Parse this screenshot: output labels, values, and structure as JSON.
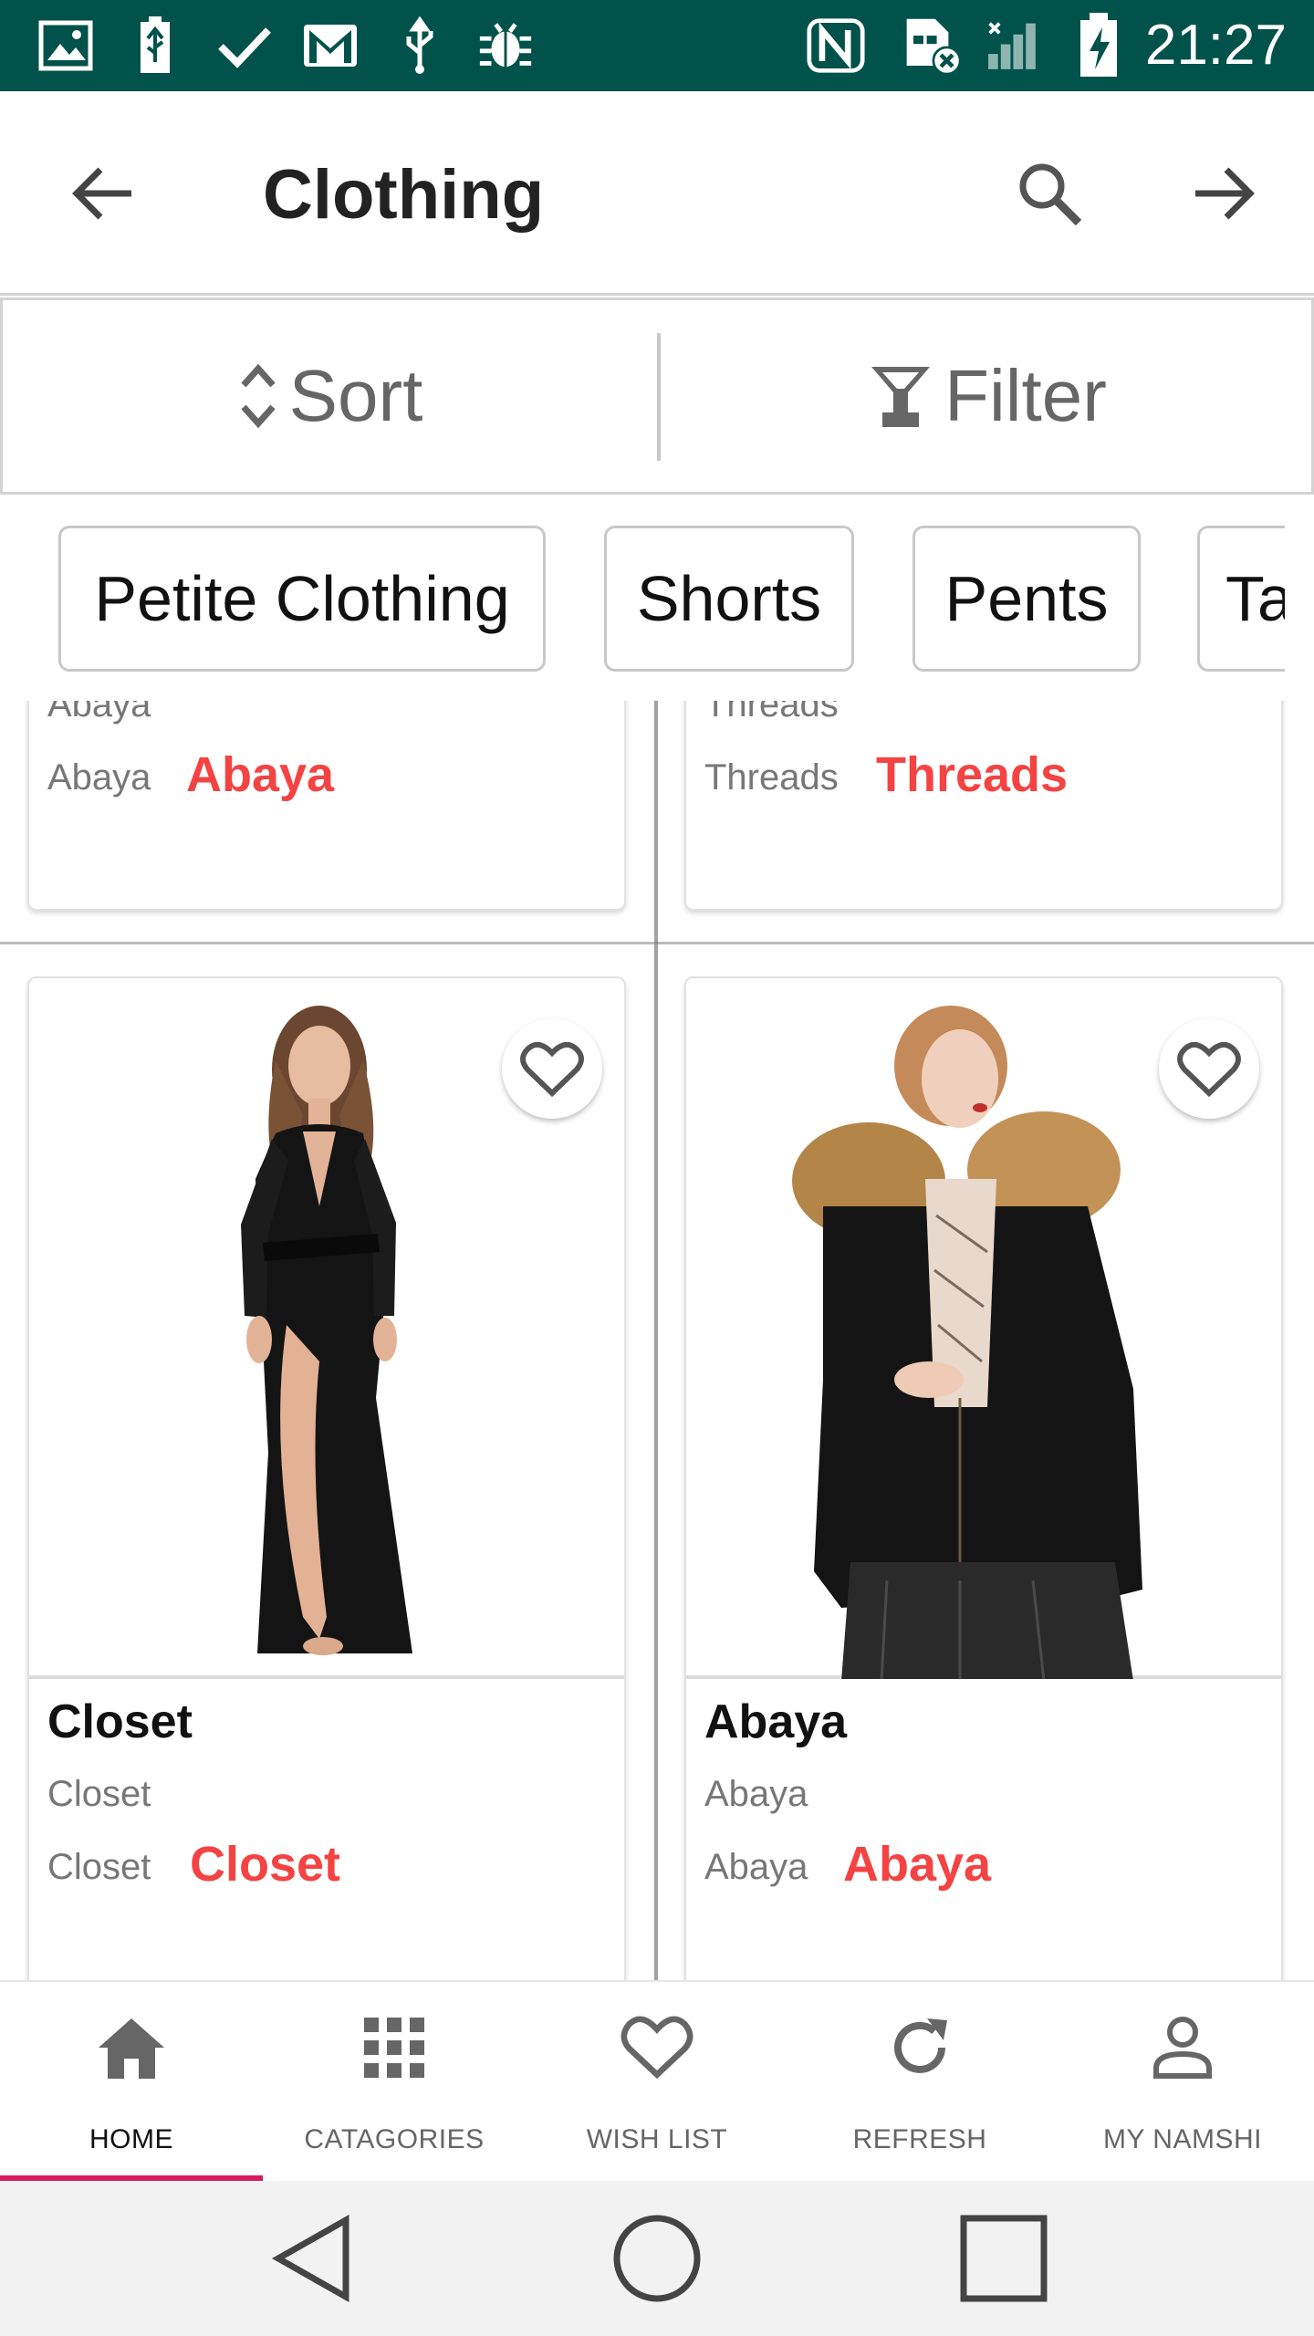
{
  "status_bar": {
    "time": "21:27",
    "icons": [
      "gallery-icon",
      "usb-battery-icon",
      "check-icon",
      "gmail-icon",
      "usb-icon",
      "debug-bug-icon",
      "nfc-icon",
      "sim-error-icon",
      "signal-icon",
      "battery-charging-icon"
    ],
    "background": "#00524b"
  },
  "app_bar": {
    "title": "Clothing",
    "back_icon": "arrow-left-icon",
    "search_icon": "search-icon",
    "forward_icon": "arrow-right-icon"
  },
  "sort_filter": {
    "sort_label": "Sort",
    "filter_label": "Filter"
  },
  "chips": [
    "Petite Clothing",
    "Shorts",
    "Pents",
    "Ta"
  ],
  "top_cards": [
    {
      "sub_clipped": "Abaya",
      "sub": "Abaya",
      "price": "Abaya"
    },
    {
      "sub_clipped": "Threads",
      "sub": "Threads",
      "price": "Threads"
    }
  ],
  "products": [
    {
      "brand": "Closet",
      "name": "Closet",
      "sub": "Closet",
      "price": "Closet",
      "image": "black-velvet-maxi-dress"
    },
    {
      "brand": "Abaya",
      "name": "Abaya",
      "sub": "Abaya",
      "price": "Abaya",
      "image": "black-parka-fur-hood"
    }
  ],
  "bottom_nav": [
    {
      "label": "HOME",
      "icon": "home-icon",
      "active": true
    },
    {
      "label": "CATAGORIES",
      "icon": "grid-icon",
      "active": false
    },
    {
      "label": "WISH LIST",
      "icon": "heart-icon",
      "active": false
    },
    {
      "label": "REFRESH",
      "icon": "refresh-icon",
      "active": false
    },
    {
      "label": "MY NAMSHI",
      "icon": "person-icon",
      "active": false
    }
  ],
  "colors": {
    "accent_price": "#f44343",
    "nav_indicator": "#d81b60",
    "status_bar": "#00524b"
  }
}
